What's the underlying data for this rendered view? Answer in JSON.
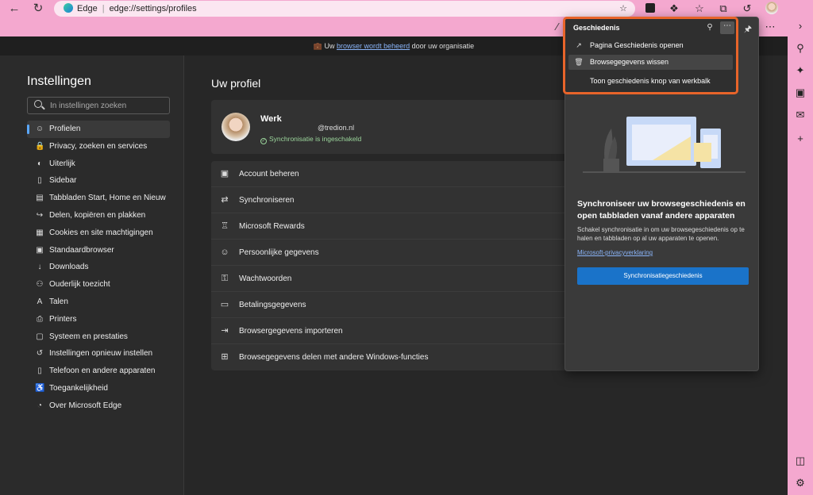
{
  "browser": {
    "address_label": "Edge",
    "address_url": "edge://settings/profiles"
  },
  "banner": {
    "prefix": "Uw",
    "link": "browser wordt beheerd",
    "suffix": "door uw organisatie"
  },
  "settings": {
    "title": "Instellingen",
    "search_placeholder": "In instellingen zoeken",
    "nav": [
      {
        "label": "Profielen",
        "icon": "profile-icon",
        "active": true
      },
      {
        "label": "Privacy, zoeken en services",
        "icon": "lock-icon"
      },
      {
        "label": "Uiterlijk",
        "icon": "palette-icon"
      },
      {
        "label": "Sidebar",
        "icon": "sidebar-icon"
      },
      {
        "label": "Tabbladen Start, Home en Nieuw",
        "icon": "tabs-icon"
      },
      {
        "label": "Delen, kopiëren en plakken",
        "icon": "share-icon"
      },
      {
        "label": "Cookies en site machtigingen",
        "icon": "cookie-icon"
      },
      {
        "label": "Standaardbrowser",
        "icon": "browser-icon"
      },
      {
        "label": "Downloads",
        "icon": "download-icon"
      },
      {
        "label": "Ouderlijk toezicht",
        "icon": "family-icon"
      },
      {
        "label": "Talen",
        "icon": "language-icon"
      },
      {
        "label": "Printers",
        "icon": "printer-icon"
      },
      {
        "label": "Systeem en prestaties",
        "icon": "system-icon"
      },
      {
        "label": "Instellingen opnieuw instellen",
        "icon": "reset-icon"
      },
      {
        "label": "Telefoon en andere apparaten",
        "icon": "phone-icon"
      },
      {
        "label": "Toegankelijkheid",
        "icon": "accessibility-icon"
      },
      {
        "label": "Over Microsoft Edge",
        "icon": "edge-icon"
      }
    ]
  },
  "profile": {
    "heading": "Uw profiel",
    "name": "Werk",
    "email": "@tredion.nl",
    "sync_status": "Synchronisatie is ingeschakeld",
    "menu": [
      {
        "label": "Account beheren",
        "icon": "account-icon"
      },
      {
        "label": "Synchroniseren",
        "icon": "sync-icon"
      },
      {
        "label": "Microsoft Rewards",
        "icon": "trophy-icon"
      },
      {
        "label": "Persoonlijke gegevens",
        "icon": "person-icon"
      },
      {
        "label": "Wachtwoorden",
        "icon": "key-icon"
      },
      {
        "label": "Betalingsgegevens",
        "icon": "card-icon"
      },
      {
        "label": "Browsergegevens importeren",
        "icon": "import-icon"
      },
      {
        "label": "Browsegegevens delen met andere Windows-functies",
        "icon": "windows-icon"
      }
    ]
  },
  "history_panel": {
    "title": "Geschiedenis",
    "menu": [
      {
        "label": "Pagina Geschiedenis openen",
        "icon": "open-external-icon"
      },
      {
        "label": "Browsegegevens wissen",
        "icon": "trash-icon"
      },
      {
        "label": "Toon geschiedenis knop van werkbalk",
        "icon": ""
      }
    ],
    "sync_heading": "Synchroniseer uw browsegeschiedenis en open tabbladen vanaf andere apparaten",
    "sync_desc": "Schakel synchronisatie in om uw browsegeschiedenis op te halen en tabbladen op al uw apparaten te openen.",
    "privacy_link": "Microsoft-privacyverklaring",
    "sync_button": "Synchronisatiegeschiedenis"
  },
  "colors": {
    "toolbar": "#f4a8cf",
    "highlight": "#e8642a",
    "accent": "#1a73c9"
  }
}
